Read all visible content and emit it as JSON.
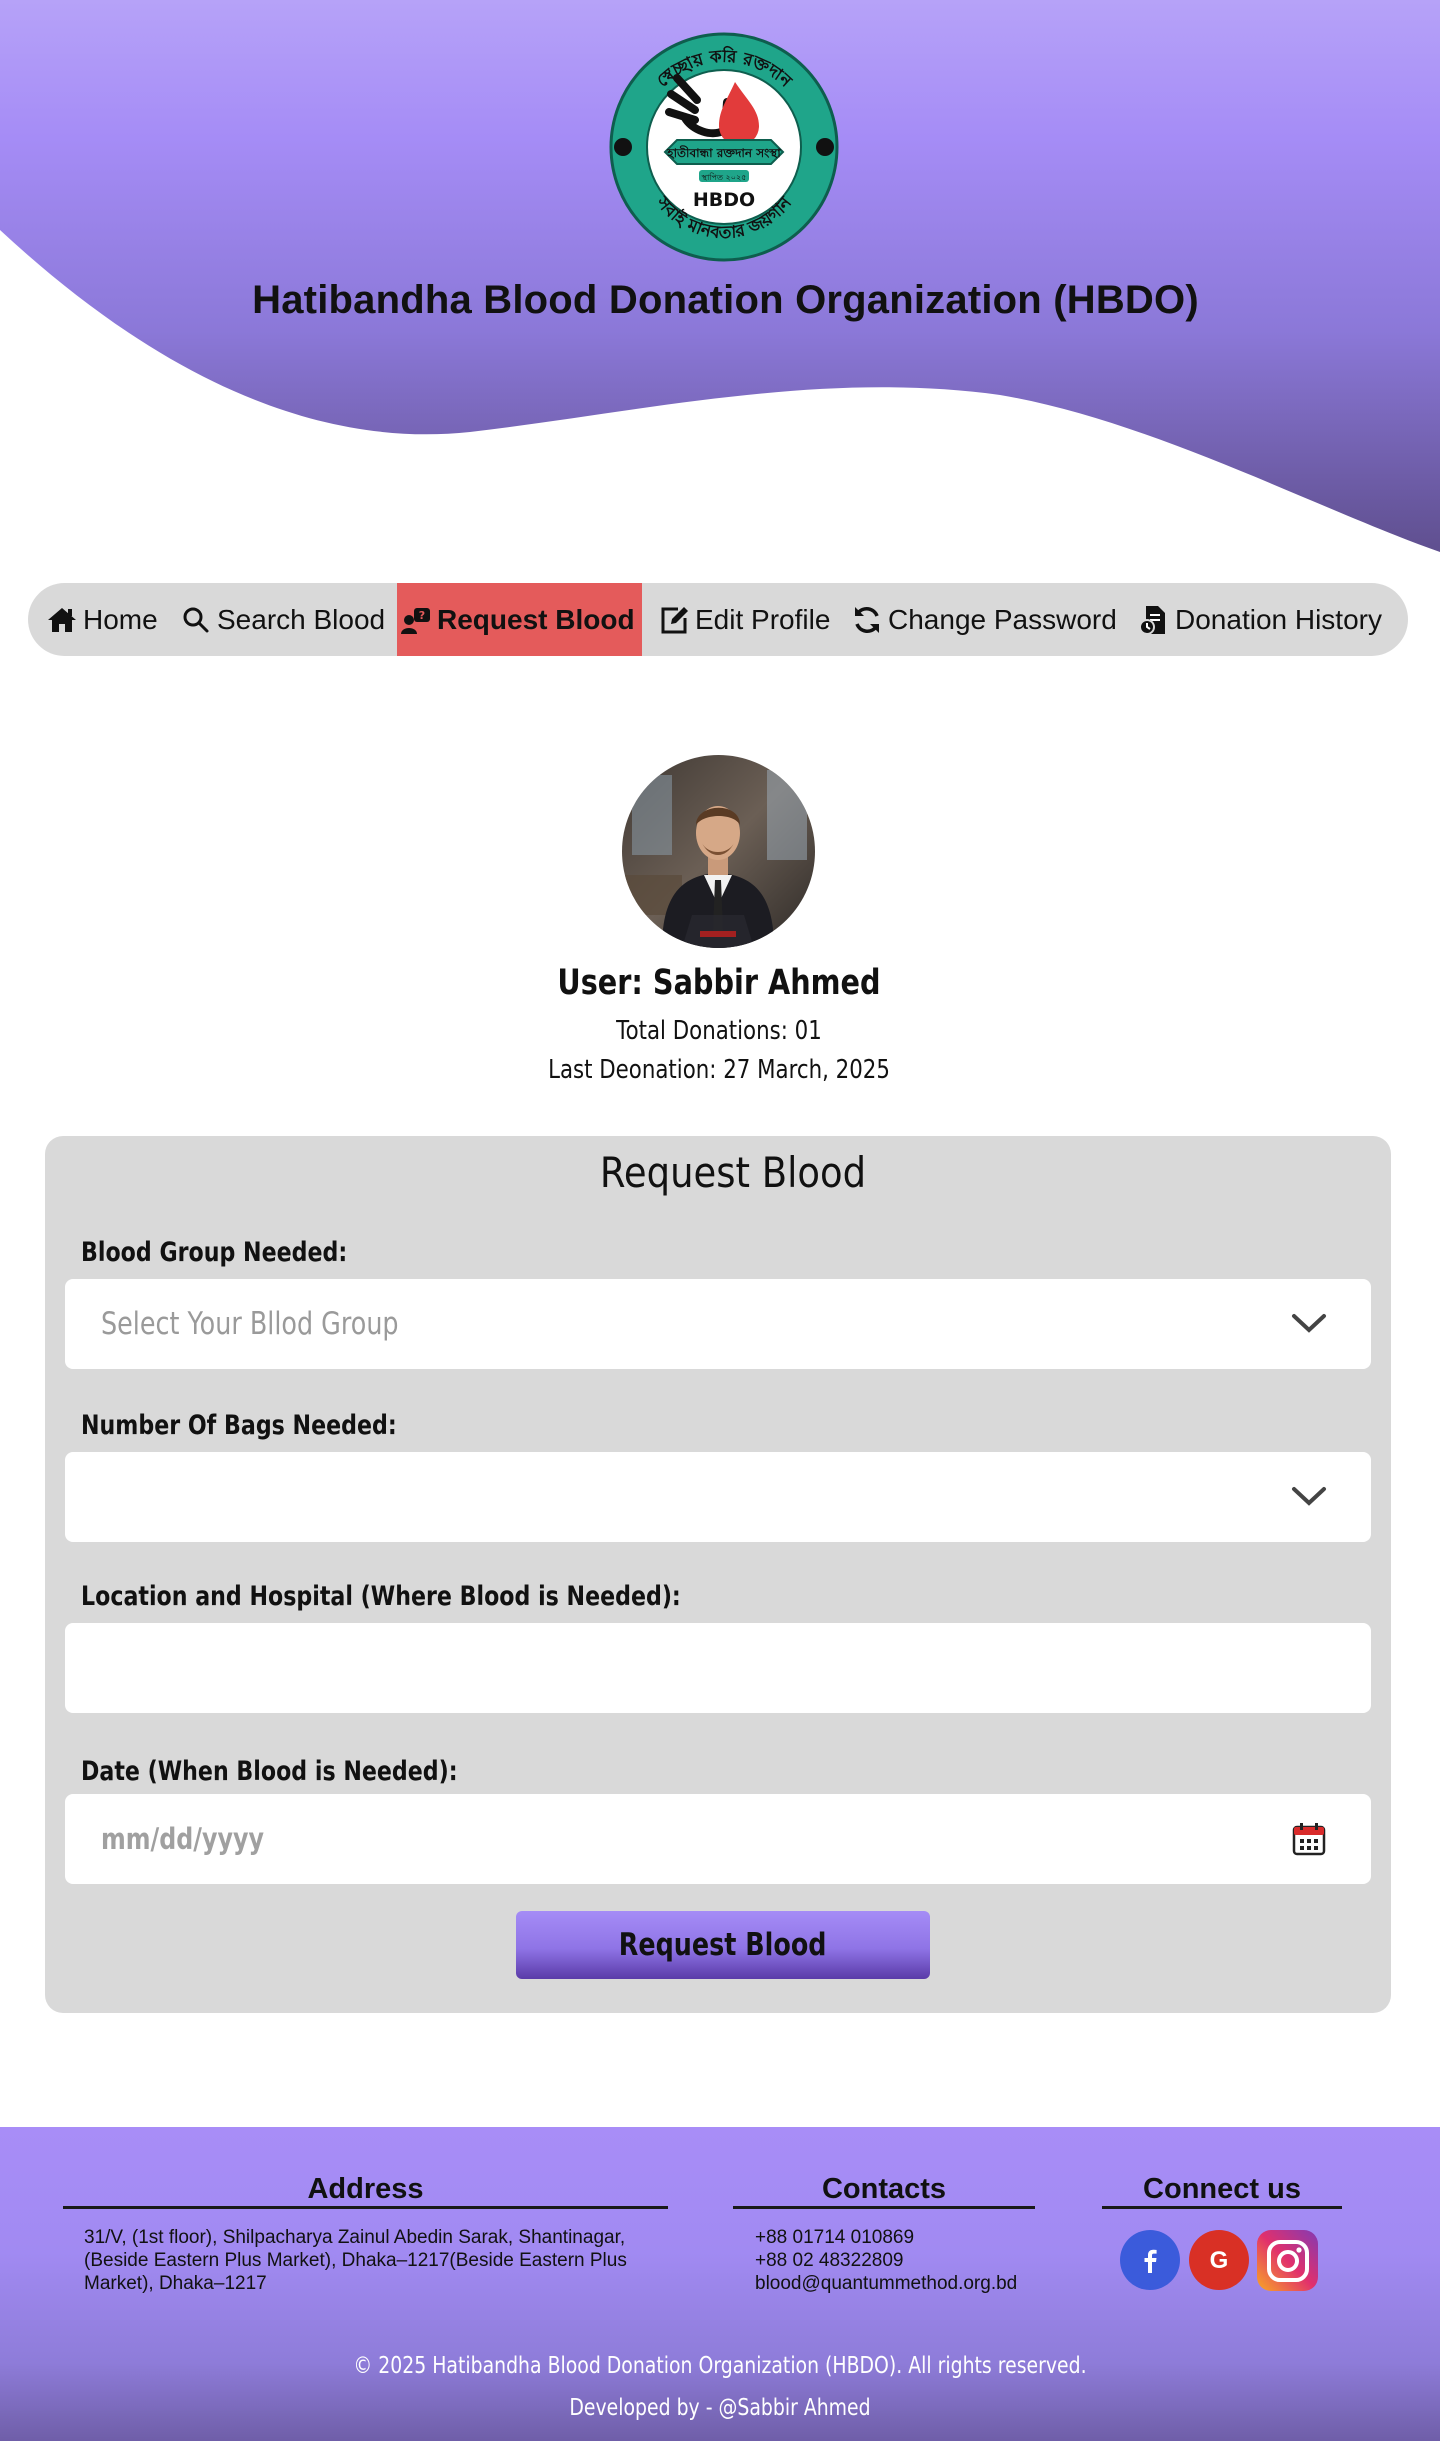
{
  "header": {
    "site_title": "Hatibandha Blood Donation Organization (HBDO)",
    "logo": {
      "top_arc_text": "স্বেচ্ছায় করি রক্তদান",
      "bottom_arc_text": "সবাই মানবতার জয়গান",
      "banner_text": "হাতীবান্ধা রক্তদান সংস্থা",
      "small_text": "স্থাপিত ২০২৫",
      "abbr": "HBDO"
    }
  },
  "nav": {
    "items": [
      {
        "label": "Home",
        "icon": "home-icon"
      },
      {
        "label": "Search Blood",
        "icon": "search-icon"
      },
      {
        "label": "Request Blood",
        "icon": "request-icon",
        "active": true
      },
      {
        "label": "Edit Profile",
        "icon": "edit-icon"
      },
      {
        "label": "Change Password",
        "icon": "refresh-icon"
      },
      {
        "label": "Donation History",
        "icon": "history-icon"
      }
    ]
  },
  "profile": {
    "name": "User: Sabbir Ahmed",
    "total_donations": "Total Donations: 01",
    "last_donation": "Last Deonation: 27 March, 2025"
  },
  "form": {
    "title": "Request Blood",
    "blood_group_label": "Blood Group Needed:",
    "blood_group_placeholder": "Select Your Bllod Group",
    "bags_label": "Number Of Bags Needed:",
    "bags_value": "",
    "location_label": "Location and Hospital (Where Blood is Needed):",
    "location_value": "",
    "date_label": "Date (When Blood is Needed):",
    "date_placeholder": "mm/dd/yyyy",
    "submit_label": "Request Blood"
  },
  "footer": {
    "address_title": "Address",
    "address_text": "31/V, (1st floor), Shilpacharya Zainul Abedin Sarak, Shantinagar, (Beside Eastern Plus Market), Dhaka–1217(Beside Eastern Plus Market), Dhaka–1217",
    "contacts_title": "Contacts",
    "contacts": [
      "+88 01714 010869",
      "+88 02 48322809",
      "blood@quantummethod.org.bd"
    ],
    "connect_title": "Connect us",
    "social": [
      {
        "icon": "facebook-icon",
        "color": "#3b5bdb"
      },
      {
        "icon": "google-icon",
        "color": "#d93025"
      },
      {
        "icon": "instagram-icon",
        "color": "#c13584"
      }
    ],
    "copyright": "© 2025 Hatibandha Blood Donation Organization (HBDO). All rights reserved.",
    "developer": "Developed by - @Sabbir Ahmed"
  },
  "colors": {
    "purple": "#a88df7",
    "nav_bg": "#d9d9d9",
    "active_tab": "#e45b5b",
    "logo_ring": "#1fa58a"
  }
}
